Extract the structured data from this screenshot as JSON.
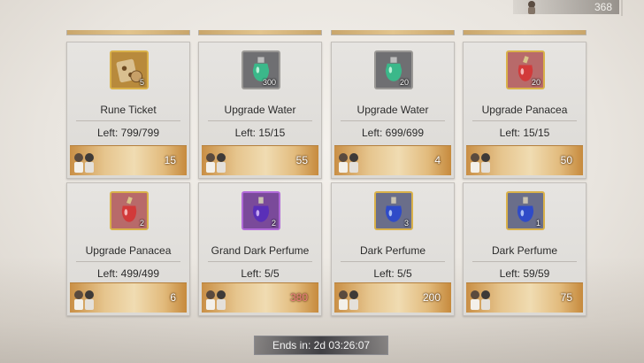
{
  "currency": {
    "value": "368",
    "icon": "character-chibi-icon"
  },
  "timer": {
    "text": "Ends in: 2d 03:26:07"
  },
  "colors": {
    "price_bar": "#e2c48d",
    "frame_gold": "#d9b14a",
    "frame_gray": "#9a9895",
    "frame_purple": "#b06ad8",
    "price_red": "#f07f7f"
  },
  "shop": {
    "items": [
      {
        "name": "Rune Ticket",
        "left": "Left: 799/799",
        "qty": "5",
        "price": "15",
        "icon": "rune-ticket-icon",
        "frame": "gold"
      },
      {
        "name": "Upgrade Water",
        "left": "Left: 15/15",
        "qty": "300",
        "price": "55",
        "icon": "green-potion-icon",
        "frame": "gray"
      },
      {
        "name": "Upgrade Water",
        "left": "Left: 699/699",
        "qty": "20",
        "price": "4",
        "icon": "green-potion-icon",
        "frame": "gray"
      },
      {
        "name": "Upgrade Panacea",
        "left": "Left: 15/15",
        "qty": "20",
        "price": "50",
        "icon": "red-potion-icon",
        "frame": "gold"
      },
      {
        "name": "Upgrade Panacea",
        "left": "Left: 499/499",
        "qty": "2",
        "price": "6",
        "icon": "red-potion-icon",
        "frame": "gold"
      },
      {
        "name": "Grand Dark Perfume",
        "left": "Left: 5/5",
        "qty": "2",
        "price": "380",
        "icon": "purple-perfume-icon",
        "frame": "purple",
        "price_color": "red"
      },
      {
        "name": "Dark Perfume",
        "left": "Left: 5/5",
        "qty": "3",
        "price": "200",
        "icon": "blue-perfume-icon",
        "frame": "gold"
      },
      {
        "name": "Dark Perfume",
        "left": "Left: 59/59",
        "qty": "1",
        "price": "75",
        "icon": "blue-perfume-icon",
        "frame": "gold"
      }
    ]
  }
}
